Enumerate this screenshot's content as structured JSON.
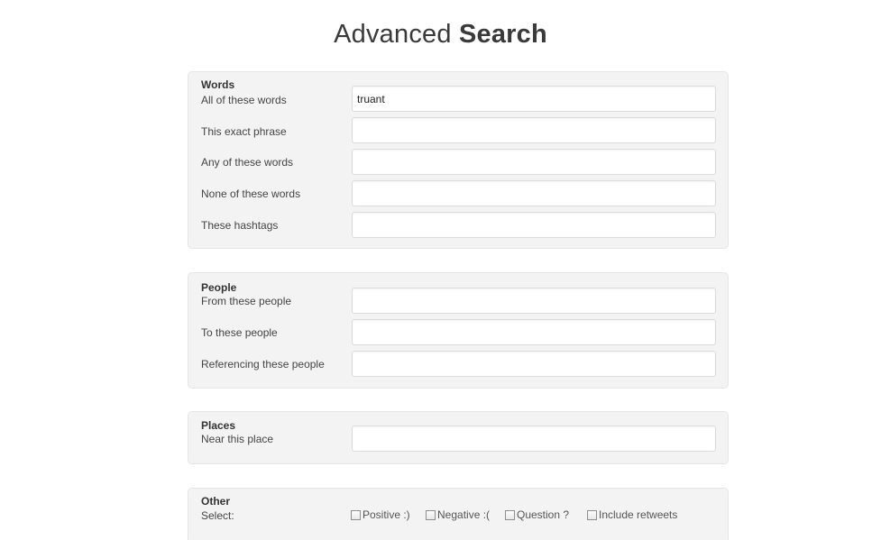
{
  "page": {
    "title_light": "Advanced",
    "title_bold": "Search"
  },
  "words": {
    "heading": "Words",
    "rows": [
      {
        "label": "All of these words",
        "value": "truant"
      },
      {
        "label": "This exact phrase",
        "value": ""
      },
      {
        "label": "Any of these words",
        "value": ""
      },
      {
        "label": "None of these words",
        "value": ""
      },
      {
        "label": "These hashtags",
        "value": ""
      }
    ]
  },
  "people": {
    "heading": "People",
    "rows": [
      {
        "label": "From these people",
        "value": ""
      },
      {
        "label": "To these people",
        "value": ""
      },
      {
        "label": "Referencing these people",
        "value": ""
      }
    ]
  },
  "places": {
    "heading": "Places",
    "rows": [
      {
        "label": "Near this place",
        "value": ""
      }
    ]
  },
  "other": {
    "heading": "Other",
    "select_label": "Select:",
    "options": [
      {
        "label": "Positive :)",
        "checked": false
      },
      {
        "label": "Negative :(",
        "checked": false
      },
      {
        "label": "Question ?",
        "checked": false
      },
      {
        "label": "Include retweets",
        "checked": false
      }
    ]
  }
}
